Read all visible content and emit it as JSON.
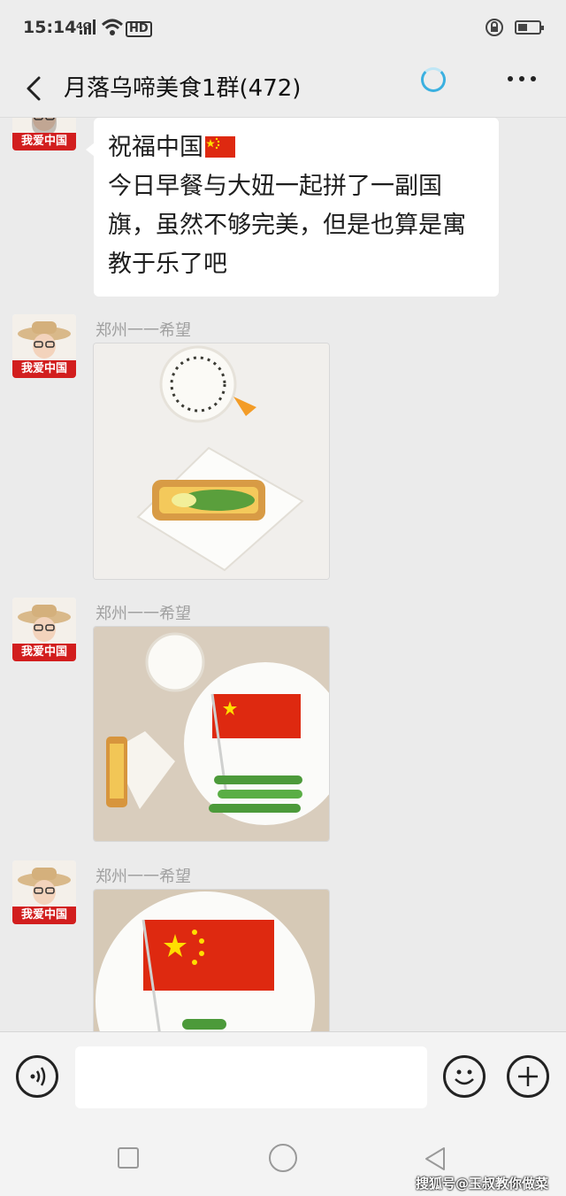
{
  "status_bar": {
    "time": "15:14",
    "network": "4G",
    "hd": "HD"
  },
  "header": {
    "title": "月落乌啼美食1群(472)"
  },
  "messages": [
    {
      "type": "text",
      "text_line1": "祝福中国",
      "text_body": "今日早餐与大妞一起拼了一副国旗，虽然不够完美，但是也算是寓教于乐了吧"
    },
    {
      "type": "image",
      "sender": "郑州一一希望"
    },
    {
      "type": "image",
      "sender": "郑州一一希望"
    },
    {
      "type": "image",
      "sender": "郑州一一希望"
    }
  ],
  "avatar": {
    "badge": "我爱中国"
  },
  "watermark": "搜狐号@玉叔教你做菜",
  "colors": {
    "flag_red": "#de2910",
    "flag_yellow": "#ffde00",
    "accent": "#3ab0e0"
  }
}
